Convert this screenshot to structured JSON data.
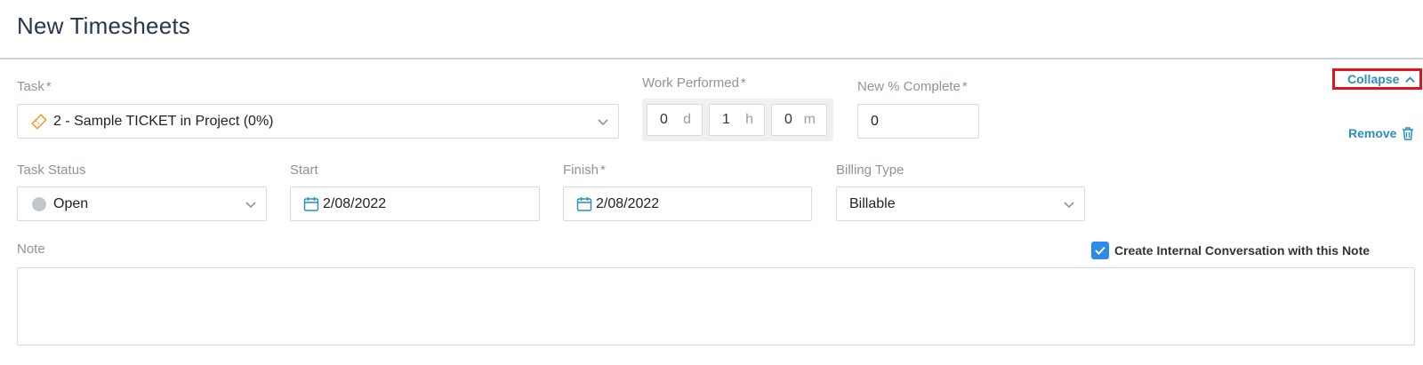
{
  "page": {
    "title": "New Timesheets"
  },
  "task": {
    "label": "Task",
    "required_mark": "*",
    "value": "2 - Sample TICKET in Project (0%)",
    "icon": "ticket-icon"
  },
  "work_performed": {
    "label": "Work Performed",
    "required_mark": "*",
    "days": "0",
    "days_unit": "d",
    "hours": "1",
    "hours_unit": "h",
    "minutes": "0",
    "minutes_unit": "m"
  },
  "percent_complete": {
    "label": "New % Complete",
    "required_mark": "*",
    "value": "0"
  },
  "actions": {
    "collapse_label": "Collapse",
    "remove_label": "Remove"
  },
  "task_status": {
    "label": "Task Status",
    "value": "Open"
  },
  "start": {
    "label": "Start",
    "value": "2/08/2022"
  },
  "finish": {
    "label": "Finish",
    "required_mark": "*",
    "value": "2/08/2022"
  },
  "billing_type": {
    "label": "Billing Type",
    "value": "Billable"
  },
  "note": {
    "label": "Note",
    "value": ""
  },
  "internal_conversation": {
    "label": "Create Internal Conversation with this Note",
    "checked": true
  },
  "colors": {
    "accent": "#2a8fc0",
    "checkbox": "#2f8be8",
    "highlight": "#e0141e",
    "ticket": "#f0a030"
  }
}
